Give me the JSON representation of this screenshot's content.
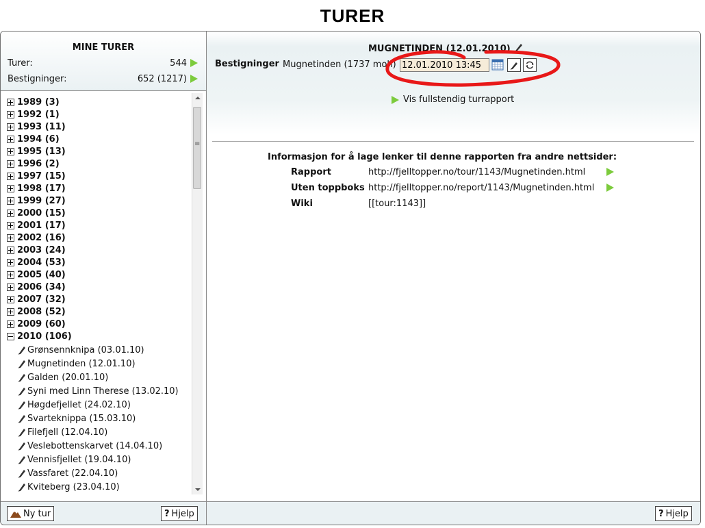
{
  "page_title": "TURER",
  "sidebar": {
    "title": "MINE TURER",
    "turer_label": "Turer:",
    "turer_value": "544",
    "bestigninger_label": "Bestigninger:",
    "bestigninger_value": "652 (1217)",
    "years": [
      {
        "label": "1989 (3)",
        "expanded": false
      },
      {
        "label": "1992 (1)",
        "expanded": false
      },
      {
        "label": "1993 (11)",
        "expanded": false
      },
      {
        "label": "1994 (6)",
        "expanded": false
      },
      {
        "label": "1995 (13)",
        "expanded": false
      },
      {
        "label": "1996 (2)",
        "expanded": false
      },
      {
        "label": "1997 (15)",
        "expanded": false
      },
      {
        "label": "1998 (17)",
        "expanded": false
      },
      {
        "label": "1999 (27)",
        "expanded": false
      },
      {
        "label": "2000 (15)",
        "expanded": false
      },
      {
        "label": "2001 (17)",
        "expanded": false
      },
      {
        "label": "2002 (16)",
        "expanded": false
      },
      {
        "label": "2003 (24)",
        "expanded": false
      },
      {
        "label": "2004 (53)",
        "expanded": false
      },
      {
        "label": "2005 (40)",
        "expanded": false
      },
      {
        "label": "2006 (34)",
        "expanded": false
      },
      {
        "label": "2007 (32)",
        "expanded": false
      },
      {
        "label": "2008 (52)",
        "expanded": false
      },
      {
        "label": "2009 (60)",
        "expanded": false
      },
      {
        "label": "2010 (106)",
        "expanded": true
      }
    ],
    "tours_2010": [
      "Grønsennknipa (03.01.10)",
      "Mugnetinden (12.01.10)",
      "Galden (20.01.10)",
      "Syni med Linn Therese (13.02.10)",
      "Høgdefjellet (24.02.10)",
      "Svarteknippa (15.03.10)",
      "Filefjell (12.04.10)",
      "Veslebottenskarvet (14.04.10)",
      "Vennisfjellet (19.04.10)",
      "Vassfaret (22.04.10)",
      "Kviteberg (23.04.10)"
    ],
    "new_tour_button": "Ny tur",
    "help_button": "Hjelp"
  },
  "main": {
    "title": "MUGNETINDEN (12.01.2010)",
    "bestigninger_label": "Bestigninger",
    "bestigninger_value": "Mugnetinden (1737 moh)",
    "date_value": "12.01.2010 13:45",
    "full_report_link": "Vis fullstendig turrapport",
    "info_title": "Informasjon for å lage lenker til denne rapporten fra andre nettsider:",
    "links": [
      {
        "label": "Rapport",
        "value": "http://fjelltopper.no/tour/1143/Mugnetinden.html",
        "arrow": true
      },
      {
        "label": "Uten toppboks",
        "value": "http://fjelltopper.no/report/1143/Mugnetinden.html",
        "arrow": true
      },
      {
        "label": "Wiki",
        "value": "[[tour:1143]]",
        "arrow": false
      }
    ],
    "help_button": "Hjelp"
  },
  "colors": {
    "accent_green": "#7ccb3c",
    "panel_bg": "#eaf1f3",
    "input_bg": "#f6ecd9",
    "annotation_red": "#e81818"
  },
  "icons": [
    "plus-icon",
    "minus-icon",
    "pencil-icon",
    "calendar-icon",
    "refresh-icon",
    "question-icon",
    "mountain-icon",
    "arrow-right-icon"
  ]
}
